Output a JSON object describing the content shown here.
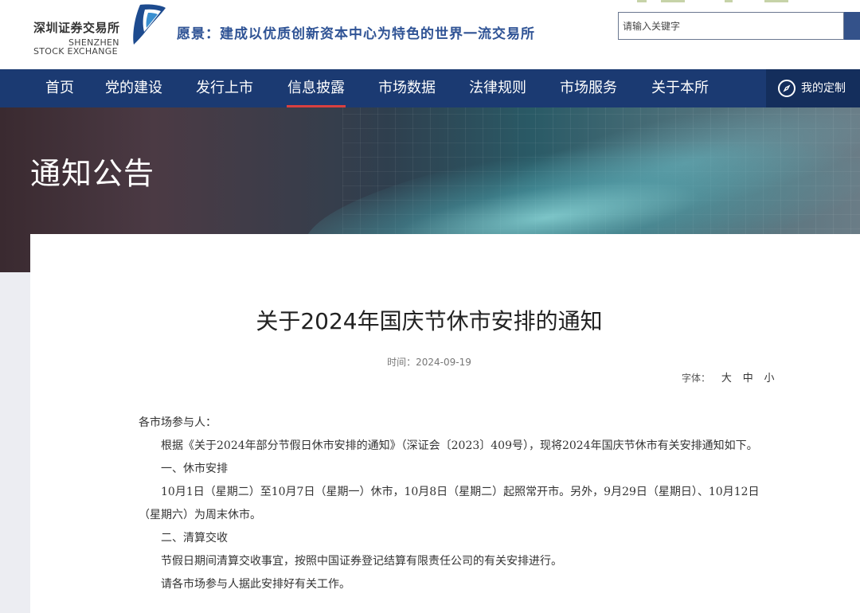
{
  "header": {
    "logo_cn": "深圳证券交易所",
    "logo_en_line1": "SHENZHEN",
    "logo_en_line2": "STOCK EXCHANGE",
    "slogan": "愿景：建成以优质创新资本中心为特色的世界一流交易所",
    "search_placeholder": "请输入关键字",
    "brand_color": "#1b3a72"
  },
  "nav": {
    "items": [
      {
        "label": "首页"
      },
      {
        "label": "党的建设"
      },
      {
        "label": "发行上市"
      },
      {
        "label": "信息披露",
        "active": true
      },
      {
        "label": "市场数据"
      },
      {
        "label": "法律规则"
      },
      {
        "label": "市场服务"
      },
      {
        "label": "关于本所"
      }
    ],
    "custom_label": "我的定制",
    "custom_icon": "compass-icon"
  },
  "banner": {
    "title": "通知公告"
  },
  "article": {
    "title": "关于2024年国庆节休市安排的通知",
    "date": "时间：2024-09-19",
    "font_label": "字体：",
    "font_sizes": [
      "大",
      "中",
      "小"
    ],
    "paragraphs": [
      "各市场参与人：",
      "根据《关于2024年部分节假日休市安排的通知》（深证会〔2023〕409号），现将2024年国庆节休市有关安排通知如下。",
      "一、休市安排",
      "10月1日（星期二）至10月7日（星期一）休市，10月8日（星期二）起照常开市。另外，9月29日（星期日）、10月12日",
      "（星期六）为周末休市。",
      "二、清算交收",
      "节假日期间清算交收事宜，按照中国证券登记结算有限责任公司的有关安排进行。",
      "请各市场参与人据此安排好有关工作。"
    ]
  }
}
